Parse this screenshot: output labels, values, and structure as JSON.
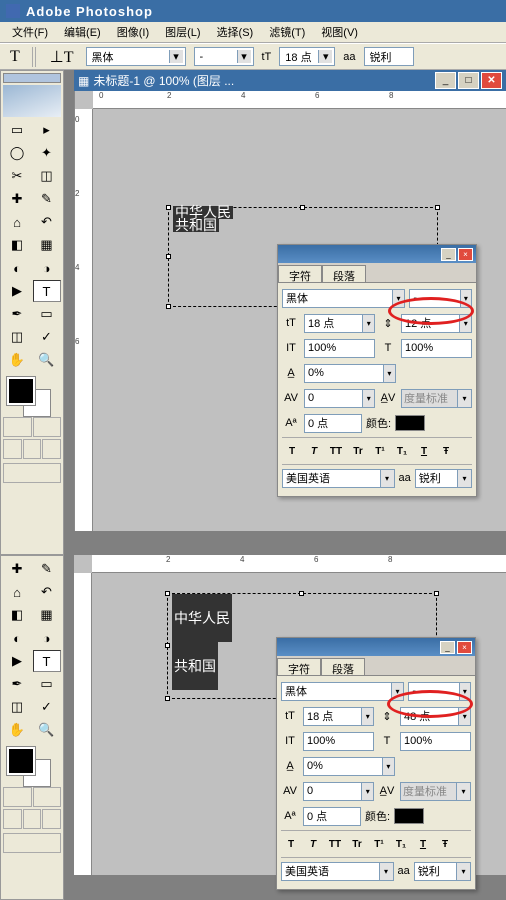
{
  "app_title": "Adobe Photoshop",
  "menu": [
    "文件(F)",
    "编辑(E)",
    "图像(I)",
    "图层(L)",
    "选择(S)",
    "滤镜(T)",
    "视图(V)"
  ],
  "options_bar": {
    "font_family": "黑体",
    "font_style": "-",
    "size_label": "T",
    "font_size": "18 点",
    "aa_label": "aa",
    "aa_mode": "锐利"
  },
  "doc_title": "未标题-1 @ 100% (图层 ...",
  "ruler_h": [
    "0",
    "2",
    "4",
    "6",
    "8"
  ],
  "ruler_v": [
    "0",
    "2",
    "4",
    "6"
  ],
  "top_view": {
    "text_line1": "中华人民",
    "text_line2": "共和国",
    "panel": {
      "tabs": [
        "字符",
        "段落"
      ],
      "font_family": "黑体",
      "font_style": "-",
      "size": "18 点",
      "leading": "12 点",
      "vscale": "100%",
      "hscale": "100%",
      "tracking": "0%",
      "kerning": "0",
      "baseline_label": "度量标准",
      "baseline_shift": "0 点",
      "color_label": "颜色:",
      "styles": [
        "T",
        "T",
        "TT",
        "Tr",
        "T¹",
        "T₁",
        "T",
        "Ŧ"
      ],
      "language": "美国英语",
      "aa_label": "aa",
      "aa": "锐利"
    }
  },
  "bottom_view": {
    "text_line1": "中华人民",
    "text_line2": "共和国",
    "panel": {
      "tabs": [
        "字符",
        "段落"
      ],
      "font_family": "黑体",
      "font_style": "-",
      "size": "18 点",
      "leading": "48 点",
      "vscale": "100%",
      "hscale": "100%",
      "tracking": "0%",
      "kerning": "0",
      "baseline_label": "度量标准",
      "baseline_shift": "0 点",
      "color_label": "颜色:",
      "styles": [
        "T",
        "T",
        "TT",
        "Tr",
        "T¹",
        "T₁",
        "T",
        "Ŧ"
      ],
      "language": "美国英语",
      "aa_label": "aa",
      "aa": "锐利"
    }
  },
  "tools": [
    "▭",
    "▶",
    "◫",
    "✛",
    "◢",
    "✂",
    "✎",
    "✐",
    "⟐",
    "⌫",
    "◉",
    "△",
    "✾",
    "⟠",
    "◐",
    "◑",
    "▶",
    "T",
    "✒",
    "▭",
    "◫",
    "◎",
    "✋",
    "🔍"
  ]
}
